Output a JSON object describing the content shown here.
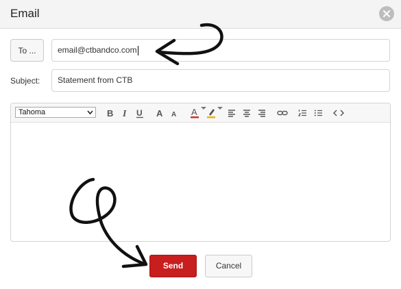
{
  "dialog": {
    "title": "Email",
    "close_icon": "close-icon"
  },
  "to": {
    "button_label": "To ...",
    "value": "email@ctbandco.com"
  },
  "subject": {
    "label": "Subject:",
    "value": "Statement from CTB"
  },
  "toolbar": {
    "font": "Tahoma",
    "icons": [
      "bold-icon",
      "italic-icon",
      "underline-icon",
      "font-size-increase-icon",
      "font-size-decrease-icon",
      "font-color-icon",
      "highlight-color-icon",
      "align-left-icon",
      "align-center-icon",
      "align-right-icon",
      "link-icon",
      "ordered-list-icon",
      "unordered-list-icon",
      "source-code-icon"
    ],
    "colors": {
      "font_color": "#d33030",
      "highlight_color": "#f2b000"
    }
  },
  "buttons": {
    "send": "Send",
    "cancel": "Cancel"
  },
  "colors": {
    "send_bg": "#c81e1e",
    "titlebar_bg": "#f4f4f4"
  }
}
